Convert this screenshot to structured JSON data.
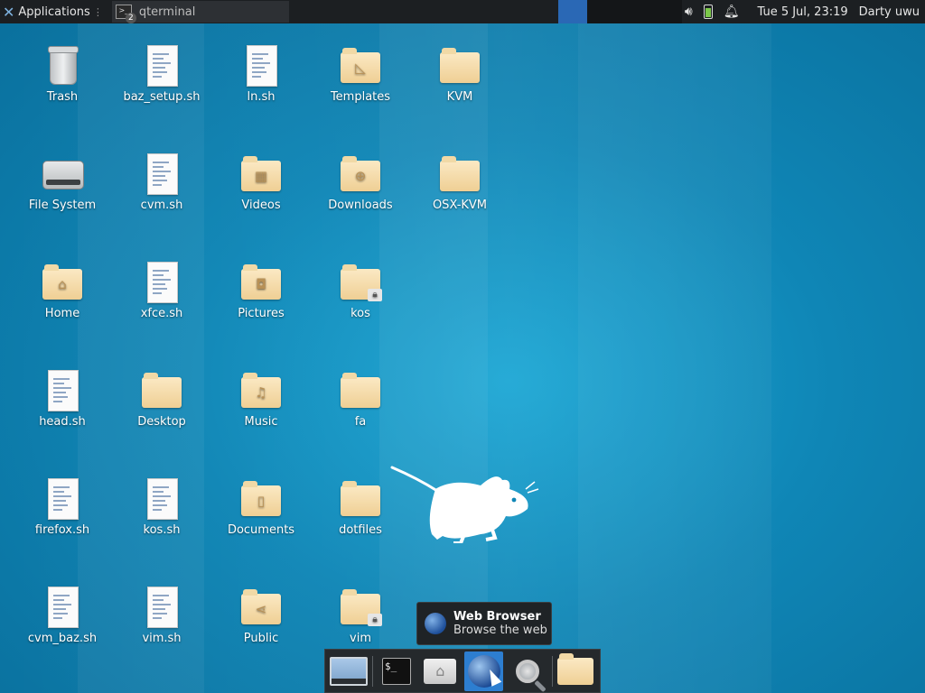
{
  "panel": {
    "applications_label": "Applications",
    "task_label": "qterminal",
    "task_badge": "2",
    "clock": "Tue  5 Jul, 23:19",
    "user": "Darty uwu"
  },
  "desktop_icons": [
    {
      "label": "Trash",
      "type": "trash"
    },
    {
      "label": "baz_setup.sh",
      "type": "script"
    },
    {
      "label": "ln.sh",
      "type": "script"
    },
    {
      "label": "Templates",
      "type": "folder",
      "emblem": "templates-icon"
    },
    {
      "label": "KVM",
      "type": "folder"
    },
    {
      "label": "File System",
      "type": "disk"
    },
    {
      "label": "cvm.sh",
      "type": "script"
    },
    {
      "label": "Videos",
      "type": "folder",
      "emblem": "film-icon"
    },
    {
      "label": "Downloads",
      "type": "folder",
      "emblem": "download-icon"
    },
    {
      "label": "OSX-KVM",
      "type": "folder"
    },
    {
      "label": "Home",
      "type": "folder",
      "emblem": "home-icon"
    },
    {
      "label": "xfce.sh",
      "type": "script"
    },
    {
      "label": "Pictures",
      "type": "folder",
      "emblem": "camera-icon"
    },
    {
      "label": "kos",
      "type": "folder",
      "emblem": "lock-icon"
    },
    {
      "label": "head.sh",
      "type": "script"
    },
    {
      "label": "Desktop",
      "type": "folder"
    },
    {
      "label": "Music",
      "type": "folder",
      "emblem": "music-note-icon"
    },
    {
      "label": "fa",
      "type": "folder"
    },
    {
      "label": "firefox.sh",
      "type": "script"
    },
    {
      "label": "kos.sh",
      "type": "script"
    },
    {
      "label": "Documents",
      "type": "folder",
      "emblem": "document-icon"
    },
    {
      "label": "dotfiles",
      "type": "folder"
    },
    {
      "label": "cvm_baz.sh",
      "type": "script"
    },
    {
      "label": "vim.sh",
      "type": "script"
    },
    {
      "label": "Public",
      "type": "folder",
      "emblem": "share-icon"
    },
    {
      "label": "vim",
      "type": "folder",
      "emblem": "lock-icon"
    }
  ],
  "tooltip": {
    "title": "Web Browser",
    "subtitle": "Browse the web"
  },
  "dock": {
    "items": [
      "show-desktop-icon",
      "terminal-icon",
      "home-folder-icon",
      "web-browser-icon",
      "app-finder-icon",
      "file-manager-icon"
    ],
    "terminal_glyph": "$_"
  }
}
